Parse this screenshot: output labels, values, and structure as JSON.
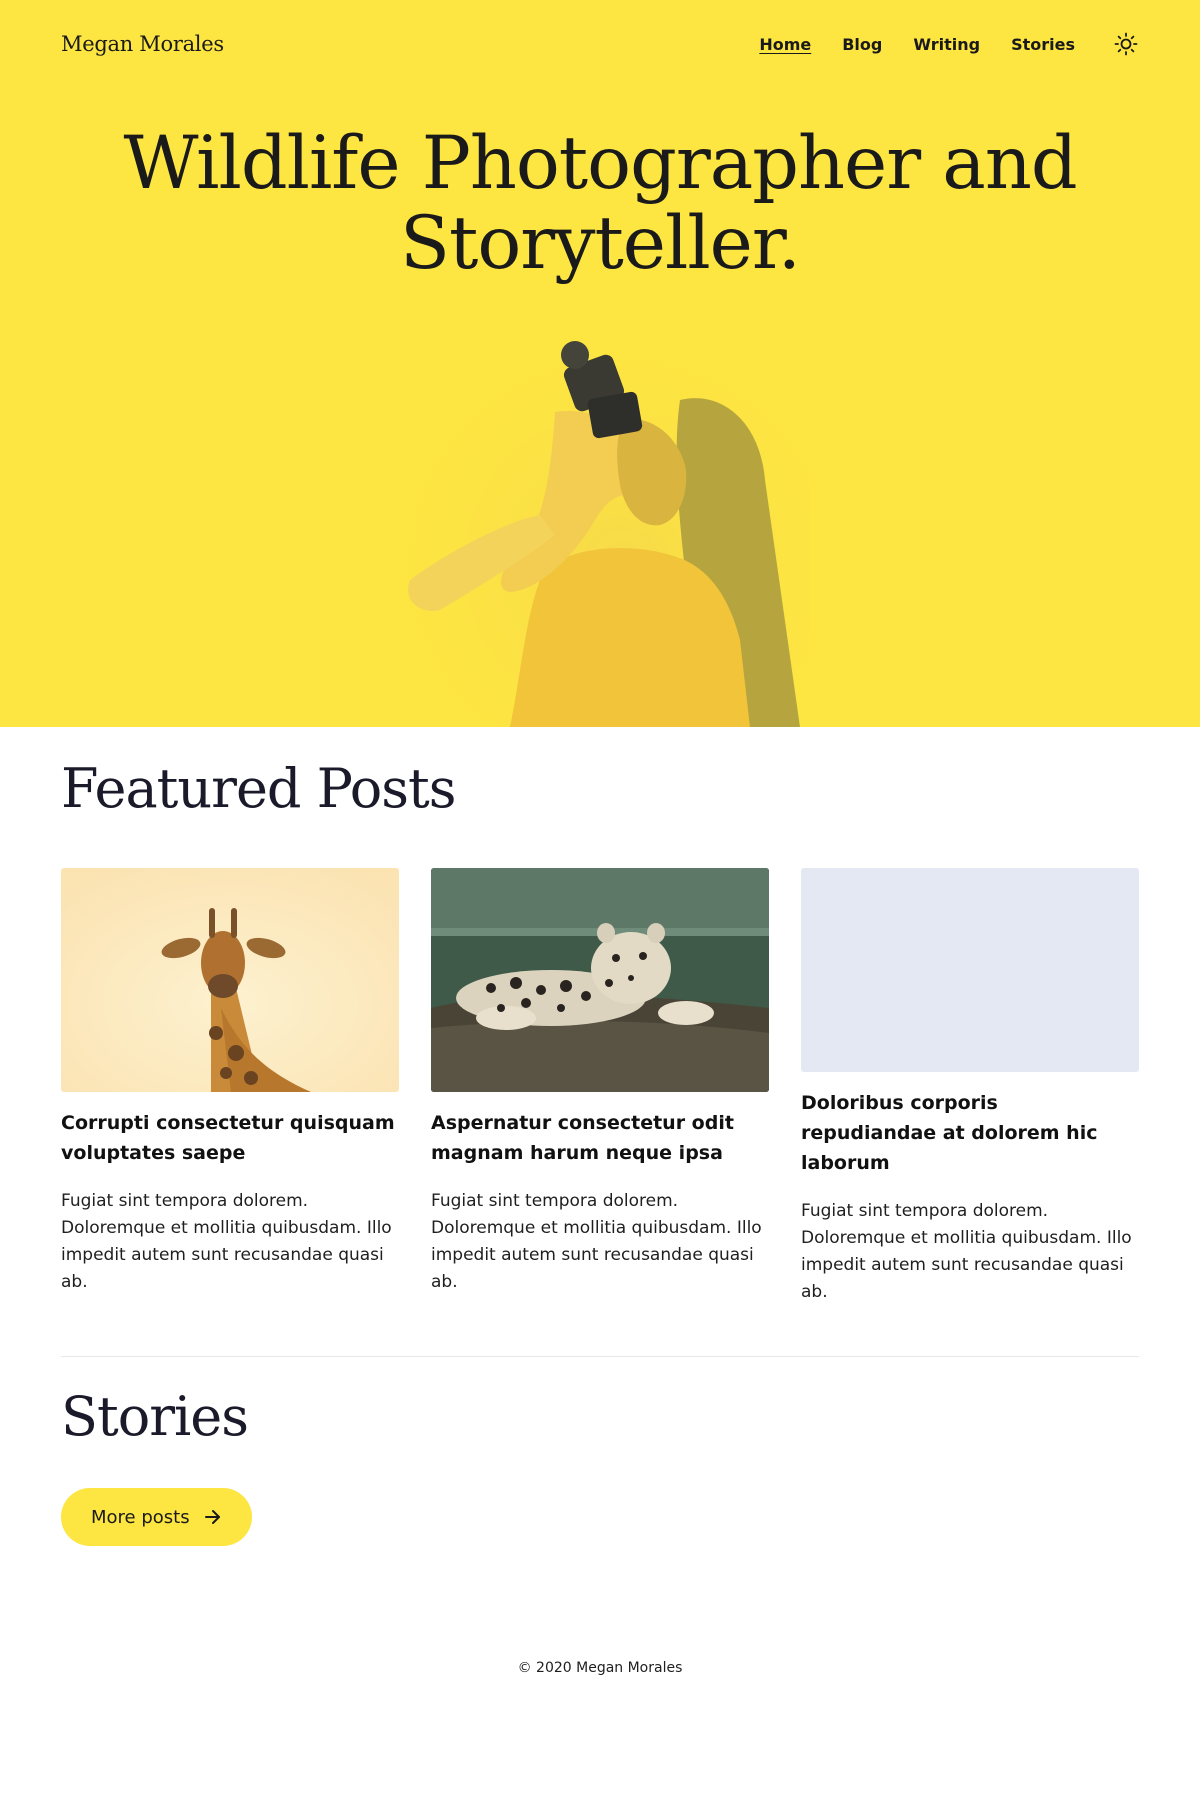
{
  "site": {
    "brand": "Megan Morales",
    "nav": [
      {
        "label": "Home",
        "active": true
      },
      {
        "label": "Blog",
        "active": false
      },
      {
        "label": "Writing",
        "active": false
      },
      {
        "label": "Stories",
        "active": false
      }
    ],
    "theme_toggle_icon": "sun-icon"
  },
  "hero": {
    "title_line1": "Wildlife Photographer and",
    "title_line2": "Storyteller.",
    "background": "#fde542"
  },
  "featured": {
    "title": "Featured Posts",
    "posts": [
      {
        "title": "Corrupti consectetur quisquam voluptates saepe",
        "excerpt": "Fugiat sint tempora dolorem. Doloremque et mollitia quibusdam. Illo impedit autem sunt recusandae quasi ab.",
        "image": "giraffe-photo"
      },
      {
        "title": "Aspernatur consectetur odit magnam harum neque ipsa",
        "excerpt": "Fugiat sint tempora dolorem. Doloremque et mollitia quibusdam. Illo impedit autem sunt recusandae quasi ab.",
        "image": "leopard-photo"
      },
      {
        "title": "Doloribus corporis repudiandae at dolorem hic laborum",
        "excerpt": "Fugiat sint tempora dolorem. Doloremque et mollitia quibusdam. Illo impedit autem sunt recusandae quasi ab.",
        "image": "placeholder"
      }
    ]
  },
  "stories": {
    "title": "Stories",
    "more_button": "More posts",
    "more_icon": "arrow-right-icon"
  },
  "footer": {
    "copyright": "© 2020 Megan Morales"
  },
  "colors": {
    "accent": "#fde542",
    "text": "#1a1a1a",
    "placeholder": "#e3e8f3"
  }
}
